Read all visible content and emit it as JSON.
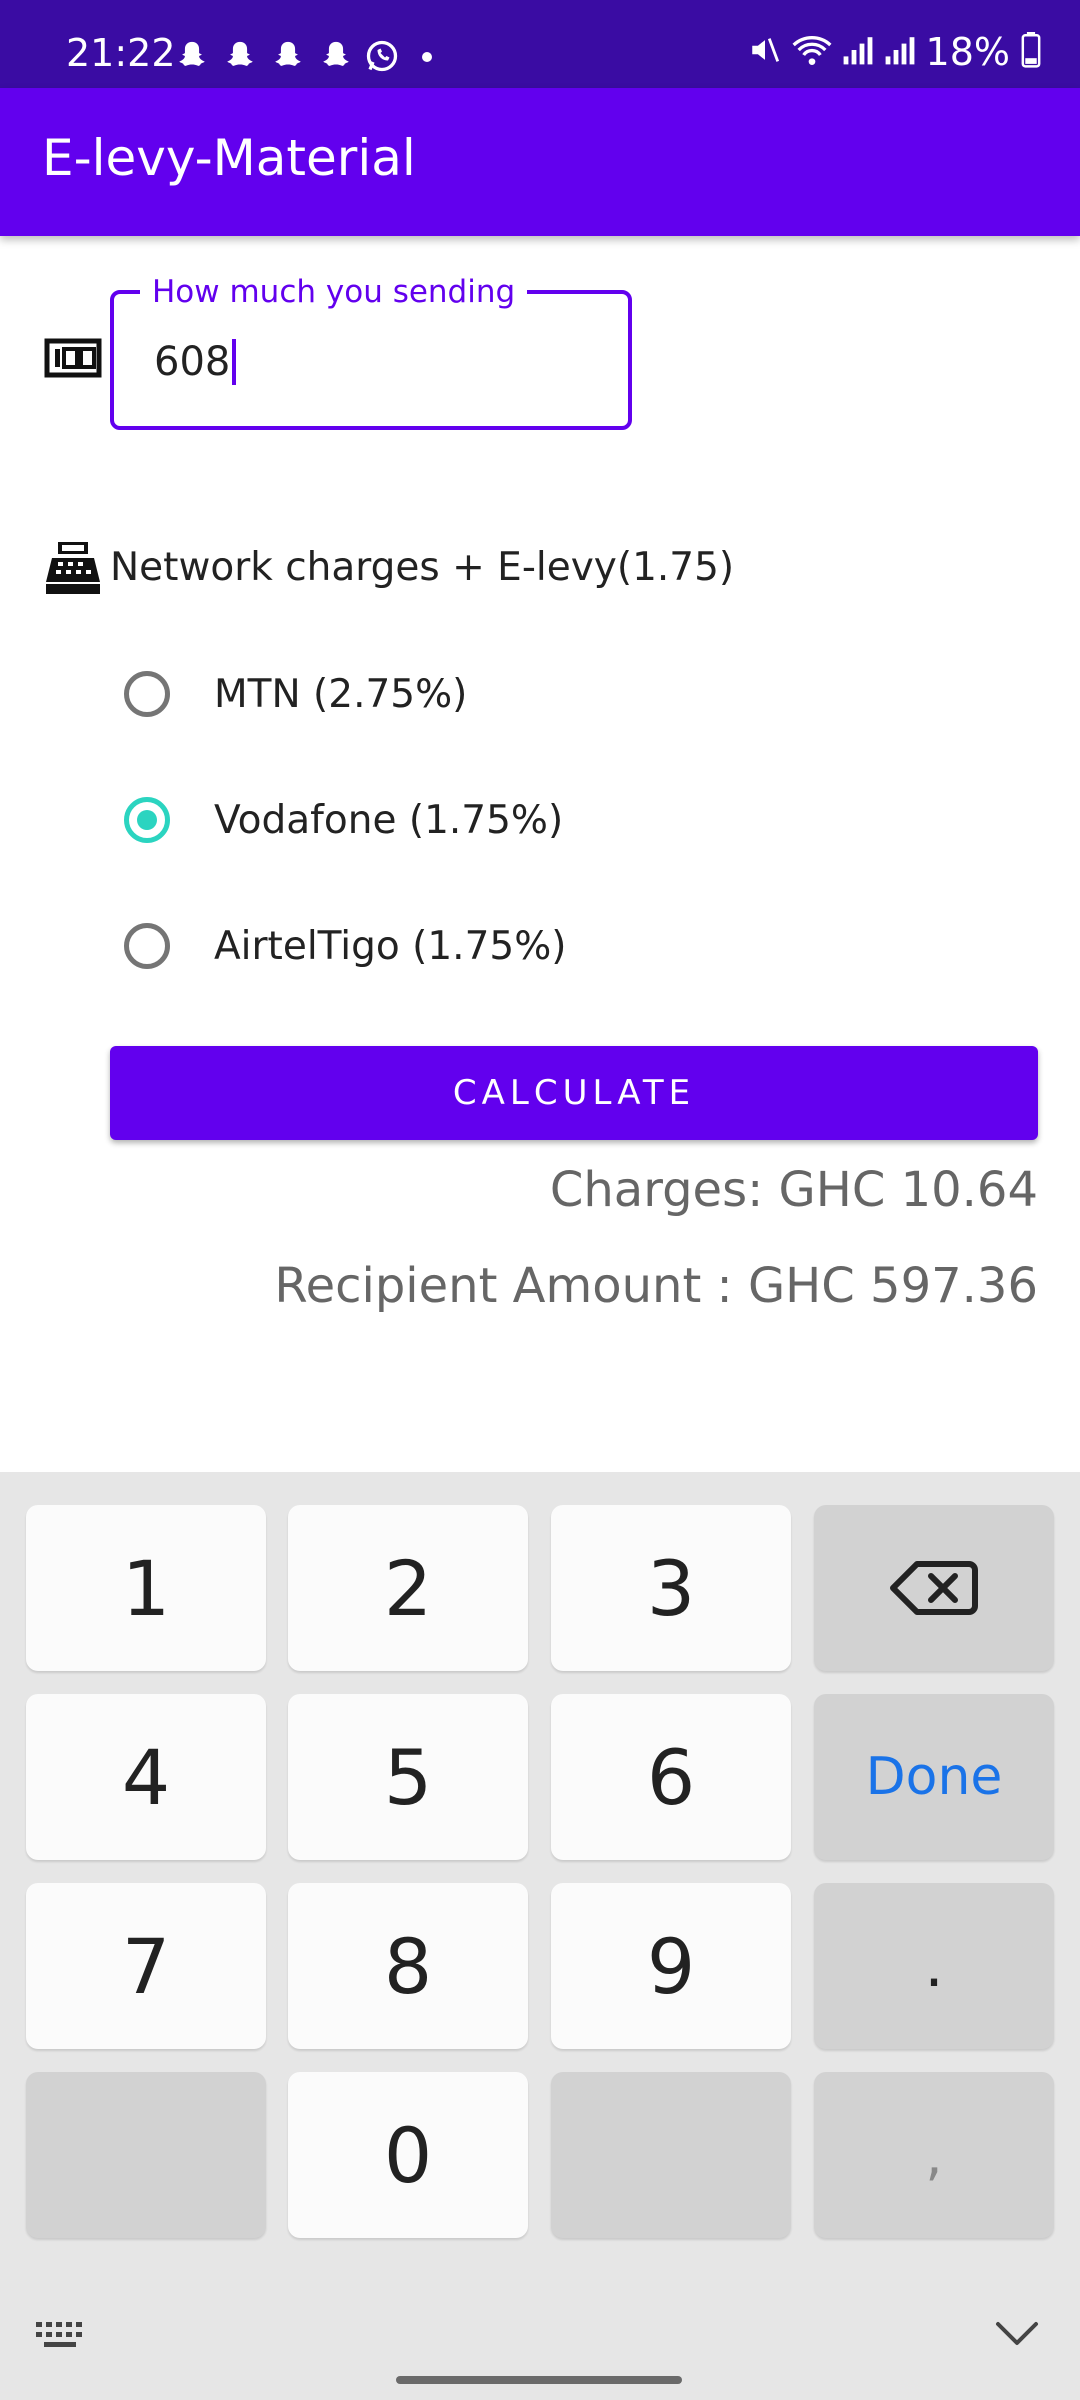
{
  "status_bar": {
    "time": "21:22",
    "battery": "18%",
    "icons": [
      "snapchat-icon",
      "snapchat-icon",
      "snapchat-icon",
      "snapchat-icon",
      "whatsapp-icon",
      "dot-icon",
      "mute-icon",
      "wifi-icon",
      "signal-icon",
      "signal-icon",
      "battery-icon"
    ]
  },
  "app_bar": {
    "title": "E-levy-Material"
  },
  "form": {
    "amount_label": "How much you sending",
    "amount_value": "608",
    "network_label": "Network charges + E-levy(1.75)",
    "options": [
      {
        "label": "MTN (2.75%)",
        "selected": false
      },
      {
        "label": "Vodafone (1.75%)",
        "selected": true
      },
      {
        "label": "AirtelTigo (1.75%)",
        "selected": false
      }
    ],
    "calculate_label": "CALCULATE",
    "charges_text": "Charges: GHC 10.64",
    "recipient_text": "Recipient Amount : GHC 597.36"
  },
  "keyboard": {
    "keys": [
      "1",
      "2",
      "3",
      "4",
      "5",
      "6",
      "7",
      "8",
      "9",
      "0"
    ],
    "done": "Done",
    "dot": ".",
    "comma": ","
  },
  "colors": {
    "primary": "#6200ee",
    "status_bar": "#3a0ca3",
    "radio_accent": "#2bd4c0",
    "done_blue": "#1a73e8"
  }
}
